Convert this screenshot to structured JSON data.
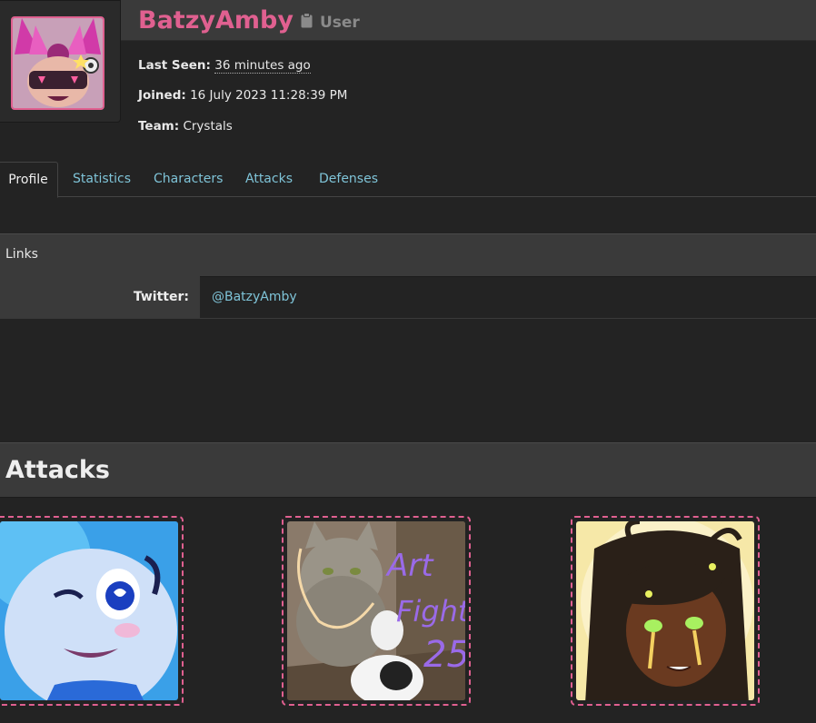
{
  "profile": {
    "username": "BatzyAmby",
    "role": "User",
    "last_seen_label": "Last Seen:",
    "last_seen_value": "36 minutes ago",
    "joined_label": "Joined:",
    "joined_value": "16 July 2023 11:28:39 PM",
    "team_label": "Team:",
    "team_value": "Crystals"
  },
  "tabs": [
    {
      "label": "Profile"
    },
    {
      "label": "Statistics"
    },
    {
      "label": "Characters"
    },
    {
      "label": "Attacks"
    },
    {
      "label": "Defenses"
    }
  ],
  "links": {
    "title": "Links",
    "rows": [
      {
        "label": "Twitter:",
        "value": "@BatzyAmby"
      }
    ]
  },
  "attacks": {
    "title": "Attacks"
  },
  "colors": {
    "accent": "#e06090",
    "link": "#7fc4d8",
    "background": "#232323",
    "panel": "#3a3a3a"
  }
}
